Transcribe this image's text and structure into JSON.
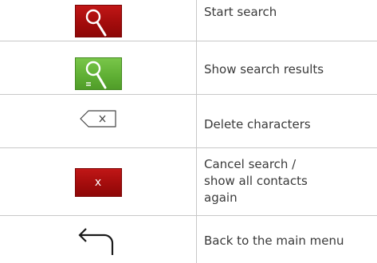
{
  "rows": [
    {
      "icon": "search-icon",
      "label": "Start search"
    },
    {
      "icon": "search-results-icon",
      "label": "Show search results"
    },
    {
      "icon": "backspace-icon",
      "label": "Delete characters"
    },
    {
      "icon": "cancel-icon",
      "icon_text": "x",
      "label": "Cancel search /\nshow all contacts\nagain"
    },
    {
      "icon": "back-arrow-icon",
      "label": "Back to the main menu"
    }
  ],
  "colors": {
    "red_button": "#a30c0c",
    "green_button": "#5eae33",
    "text": "#3a3a3a",
    "grid_line": "#c8c8c8"
  }
}
